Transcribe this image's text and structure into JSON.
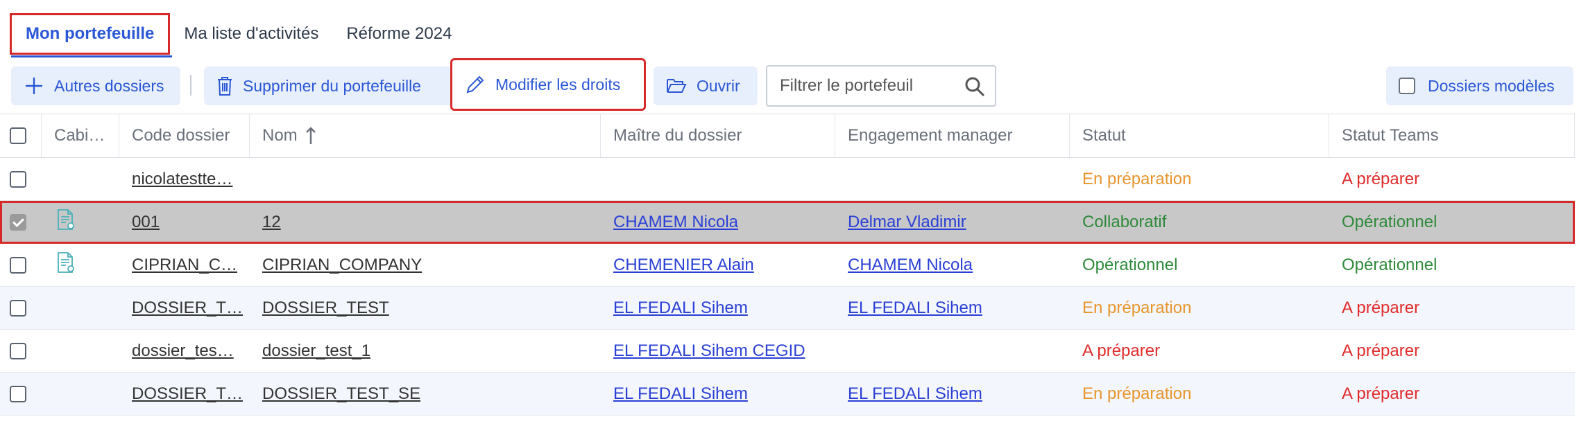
{
  "tabs": [
    {
      "label": "Mon portefeuille",
      "active": true
    },
    {
      "label": "Ma liste d'activités",
      "active": false
    },
    {
      "label": "Réforme 2024",
      "active": false
    }
  ],
  "toolbar": {
    "other_files": "Autres dossiers",
    "remove": "Supprimer du portefeuille",
    "edit_rights": "Modifier les droits",
    "open": "Ouvrir",
    "filter_placeholder": "Filtrer le portefeuil",
    "model_files": "Dossiers modèles"
  },
  "table": {
    "headers": {
      "cabinet": "Cabi…",
      "code": "Code dossier",
      "name": "Nom",
      "master": "Maître du dossier",
      "manager": "Engagement manager",
      "status": "Statut",
      "teams_status": "Statut Teams"
    },
    "rows": [
      {
        "code": "nicolatestte…",
        "name": "",
        "master": "",
        "manager": "",
        "status": "En préparation",
        "teams": "A préparer",
        "checked": false,
        "icon": false
      },
      {
        "code": "001",
        "name": "12",
        "master": "CHAMEM Nicola",
        "manager": "Delmar Vladimir",
        "status": "Collaboratif",
        "teams": "Opérationnel",
        "checked": true,
        "icon": true
      },
      {
        "code": "CIPRIAN_C…",
        "name": "CIPRIAN_COMPANY",
        "master": "CHEMENIER Alain",
        "manager": "CHAMEM Nicola",
        "status": "Opérationnel",
        "teams": "Opérationnel",
        "checked": false,
        "icon": true
      },
      {
        "code": "DOSSIER_T…",
        "name": "DOSSIER_TEST",
        "master": "EL FEDALI Sihem",
        "manager": "EL FEDALI Sihem",
        "status": "En préparation",
        "teams": "A préparer",
        "checked": false,
        "icon": false
      },
      {
        "code": "dossier_tes…",
        "name": "dossier_test_1",
        "master": "EL FEDALI Sihem CEGID",
        "manager": "",
        "status": "A préparer",
        "teams": "A préparer",
        "checked": false,
        "icon": false
      },
      {
        "code": "DOSSIER_T…",
        "name": "DOSSIER_TEST_SE",
        "master": "EL FEDALI Sihem",
        "manager": "EL FEDALI Sihem",
        "status": "En préparation",
        "teams": "A préparer",
        "checked": false,
        "icon": false
      }
    ]
  },
  "colors": {
    "accent": "#2a57d6",
    "highlight": "#d62a2a",
    "status_orange": "#e8952e",
    "status_green": "#2e8a3a",
    "status_red": "#e02b2b"
  }
}
